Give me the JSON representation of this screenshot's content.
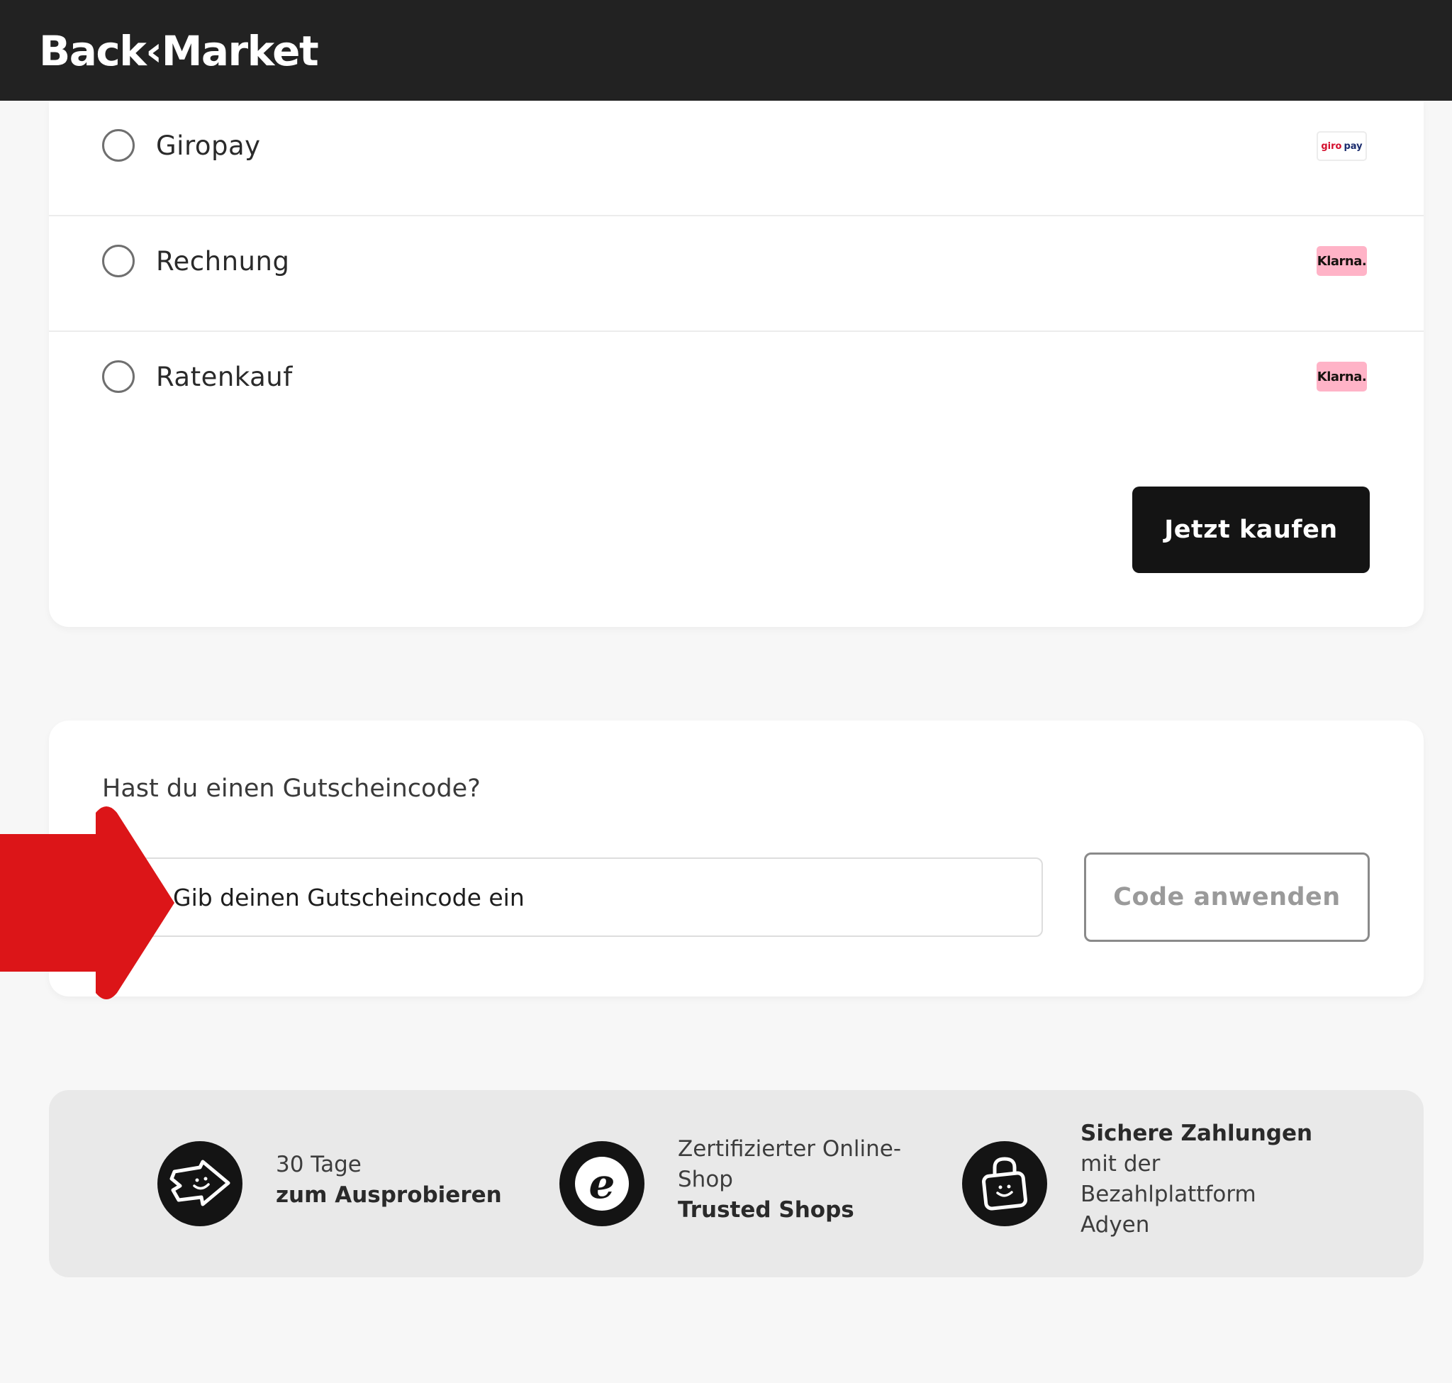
{
  "header": {
    "logo": "Back‹Market"
  },
  "payment": {
    "options": [
      {
        "label": "Giropay",
        "badge": {
          "type": "giropay",
          "text_a": "giro",
          "text_b": "pay"
        }
      },
      {
        "label": "Rechnung",
        "badge": {
          "type": "klarna",
          "text": "Klarna."
        }
      },
      {
        "label": "Ratenkauf",
        "badge": {
          "type": "klarna",
          "text": "Klarna."
        }
      }
    ],
    "buy_label": "Jetzt kaufen"
  },
  "voucher": {
    "question": "Hast du einen Gutscheincode?",
    "placeholder": "Gib deinen Gutscheincode ein",
    "apply_label": "Code anwenden"
  },
  "trust": [
    {
      "icon": "return-package-icon",
      "line1": "30 Tage",
      "bold": "zum Ausprobieren"
    },
    {
      "icon": "trusted-shops-e-icon",
      "line1": "Zertifizierter Online-",
      "line2": "Shop",
      "bold": "Trusted Shops"
    },
    {
      "icon": "secure-lock-icon",
      "bold": "Sichere Zahlungen",
      "lines": [
        "mit der",
        "Bezahlplattform",
        "Adyen"
      ]
    }
  ],
  "colors": {
    "header_bg": "#222222",
    "page_bg": "#f7f7f7",
    "klarna_pink": "#ffb3c7",
    "annotation_arrow": "#dc1518"
  }
}
